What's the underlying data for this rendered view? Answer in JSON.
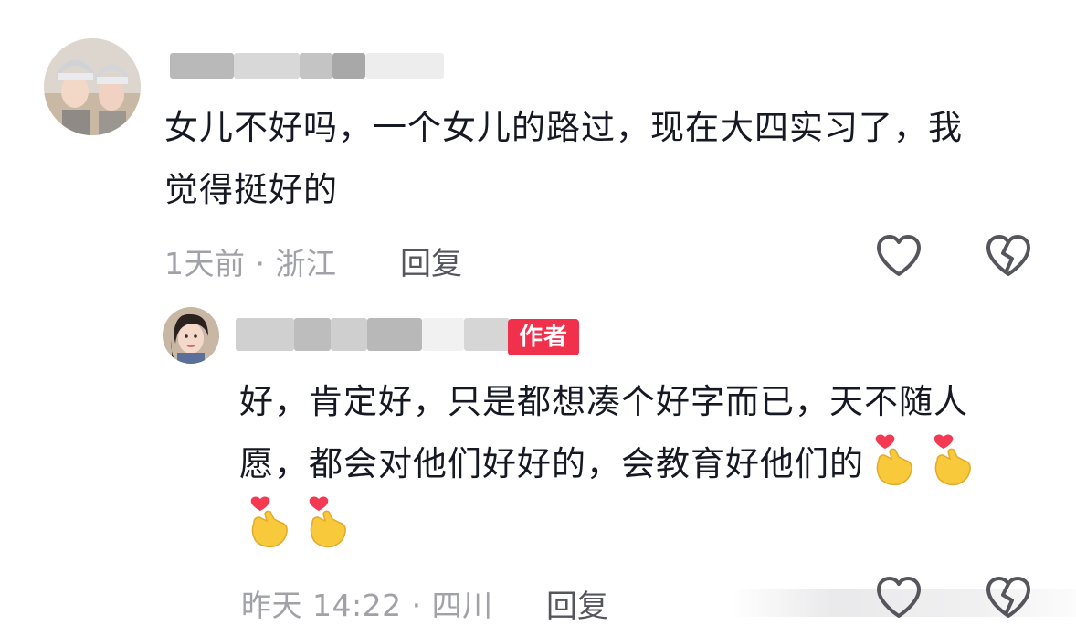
{
  "comment": {
    "text": "女儿不好吗，一个女儿的路过，现在大四实习了，我觉得挺好的",
    "time": "1天前",
    "separator": "·",
    "location": "浙江",
    "reply_label": "回复",
    "like_icon": "heart-outline-icon",
    "dislike_icon": "broken-heart-icon"
  },
  "reply": {
    "author_badge": "作者",
    "text": "好，肯定好，只是都想凑个好字而已，天不随人愿，都会对他们好好的，会教育好他们的",
    "emoji": [
      "finger-heart-emoji",
      "finger-heart-emoji",
      "finger-heart-emoji",
      "finger-heart-emoji"
    ],
    "time": "昨天 14:22",
    "separator": "·",
    "location": "四川",
    "reply_label": "回复",
    "like_icon": "heart-outline-icon",
    "dislike_icon": "broken-heart-icon"
  },
  "colors": {
    "badge": "#f1304c",
    "meta_text": "#a1a2a7",
    "body_text": "#161823",
    "icon_stroke": "#55565c"
  }
}
